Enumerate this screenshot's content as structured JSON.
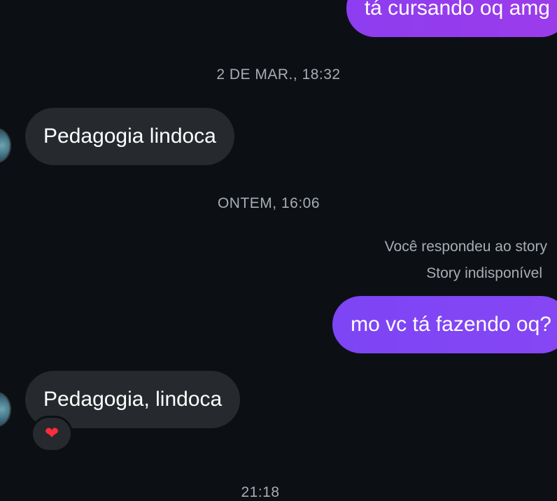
{
  "messages": [
    {
      "text": "tá cursando oq amg"
    },
    {
      "text": "Pedagogia lindoca"
    },
    {
      "text": "mo vc tá fazendo oq?"
    },
    {
      "text": "Pedagogia, lindoca"
    }
  ],
  "timestamps": [
    "2 DE MAR., 18:32",
    "ONTEM, 16:06",
    "21:18"
  ],
  "story_reply": {
    "label": "Você respondeu ao story",
    "status": "Story indisponível"
  },
  "reaction": {
    "emoji": "❤"
  },
  "colors": {
    "background": "#0c1014",
    "incoming_bubble": "#262a2f",
    "outgoing_bubble": "#8d3df0",
    "muted_text": "#a8adb3"
  }
}
